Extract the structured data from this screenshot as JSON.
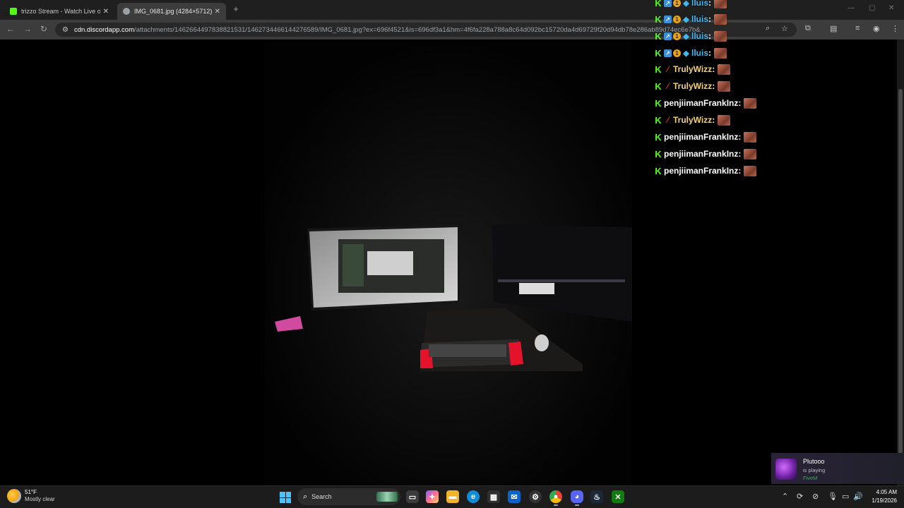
{
  "browser": {
    "tabs": [
      {
        "title": "trizzo Stream - Watch Live on K",
        "active": false,
        "favicon_color": "#53fc18"
      },
      {
        "title": "IMG_0681.jpg (4284×5712)",
        "active": true,
        "favicon_color": "#9aa0a6"
      }
    ],
    "url_host": "cdn.discordapp.com",
    "url_path": "/attachments/1462664497838821531/1462734466144276589/IMG_0681.jpg?ex=696f4521&is=696df3a1&hm=4f6fa228a788a8c64d092bc15720da4d69729f20d94db78e286ab89d74ec6e7b&"
  },
  "chat": {
    "messages": [
      {
        "user": "lluis",
        "color": "#41b7f0",
        "badges": [
          "k",
          "arrow",
          "coin",
          "gem"
        ]
      },
      {
        "user": "lluis",
        "color": "#41b7f0",
        "badges": [
          "k",
          "arrow",
          "coin",
          "gem"
        ]
      },
      {
        "user": "lluis",
        "color": "#41b7f0",
        "badges": [
          "k",
          "arrow",
          "coin",
          "gem"
        ]
      },
      {
        "user": "lluis",
        "color": "#41b7f0",
        "badges": [
          "k",
          "arrow",
          "coin",
          "gem"
        ]
      },
      {
        "user": "TrulyWizz",
        "color": "#f5d27a",
        "badges": [
          "k",
          "slash"
        ]
      },
      {
        "user": "TrulyWizz",
        "color": "#f5d27a",
        "badges": [
          "k",
          "slash"
        ]
      },
      {
        "user": "penjiimanFrankInz",
        "color": "#ffffff",
        "badges": [
          "k"
        ]
      },
      {
        "user": "TrulyWizz",
        "color": "#f5d27a",
        "badges": [
          "k",
          "slash"
        ]
      },
      {
        "user": "penjiimanFrankInz",
        "color": "#ffffff",
        "badges": [
          "k"
        ]
      },
      {
        "user": "penjiimanFrankInz",
        "color": "#ffffff",
        "badges": [
          "k"
        ]
      },
      {
        "user": "penjiimanFrankInz",
        "color": "#ffffff",
        "badges": [
          "k"
        ]
      }
    ]
  },
  "notification": {
    "name": "Plutooo",
    "status": "is playing",
    "game": "FiveM"
  },
  "taskbar": {
    "temperature": "51°F",
    "condition": "Mostly clear",
    "search_label": "Search",
    "time": "4:05 AM",
    "date": "1/19/2026"
  }
}
